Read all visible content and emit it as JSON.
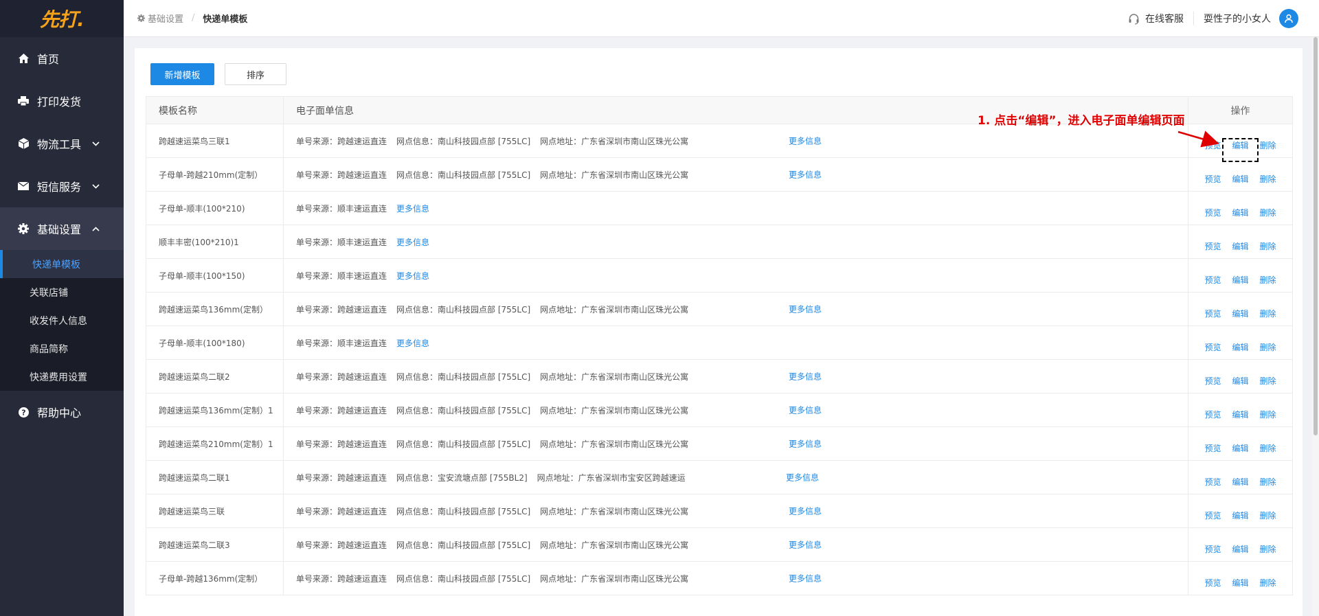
{
  "sidebar": {
    "logo": "先打.",
    "items": [
      {
        "label": "首页",
        "icon": "home-icon"
      },
      {
        "label": "打印发货",
        "icon": "printer-icon"
      },
      {
        "label": "物流工具",
        "icon": "package-icon"
      },
      {
        "label": "短信服务",
        "icon": "mail-icon"
      },
      {
        "label": "基础设置",
        "icon": "gear-icon"
      },
      {
        "label": "帮助中心",
        "icon": "help-icon"
      }
    ],
    "sub_items": [
      "快递单模板",
      "关联店铺",
      "收发件人信息",
      "商品简称",
      "快递费用设置"
    ]
  },
  "header": {
    "breadcrumb": [
      "基础设置",
      "快递单模板"
    ],
    "service": "在线客服",
    "user": "耍性子的小女人"
  },
  "toolbar": {
    "add_label": "新增模板",
    "sort_label": "排序"
  },
  "table": {
    "headers": [
      "模板名称",
      "电子面单信息",
      "操作"
    ],
    "actions": [
      "预览",
      "编辑",
      "删除"
    ],
    "more_label": "更多信息",
    "rows": [
      {
        "name": "跨越速运菜鸟三联1",
        "source": "单号来源：跨越速运直连",
        "point": "网点信息：南山科技园点部 [755LC]",
        "address": "网点地址：广东省深圳市南山区珠光公寓"
      },
      {
        "name": "子母单-跨越210mm(定制）",
        "source": "单号来源：跨越速运直连",
        "point": "网点信息：南山科技园点部 [755LC]",
        "address": "网点地址：广东省深圳市南山区珠光公寓"
      },
      {
        "name": "子母单-顺丰(100*210)",
        "source": "单号来源：顺丰速运直连",
        "point": "",
        "address": ""
      },
      {
        "name": "顺丰丰密(100*210)1",
        "source": "单号来源：顺丰速运直连",
        "point": "",
        "address": ""
      },
      {
        "name": "子母单-顺丰(100*150)",
        "source": "单号来源：顺丰速运直连",
        "point": "",
        "address": ""
      },
      {
        "name": "跨越速运菜鸟136mm(定制）",
        "source": "单号来源：跨越速运直连",
        "point": "网点信息：南山科技园点部 [755LC]",
        "address": "网点地址：广东省深圳市南山区珠光公寓"
      },
      {
        "name": "子母单-顺丰(100*180)",
        "source": "单号来源：顺丰速运直连",
        "point": "",
        "address": ""
      },
      {
        "name": "跨越速运菜鸟二联2",
        "source": "单号来源：跨越速运直连",
        "point": "网点信息：南山科技园点部 [755LC]",
        "address": "网点地址：广东省深圳市南山区珠光公寓"
      },
      {
        "name": "跨越速运菜鸟136mm(定制）1",
        "source": "单号来源：跨越速运直连",
        "point": "网点信息：南山科技园点部 [755LC]",
        "address": "网点地址：广东省深圳市南山区珠光公寓"
      },
      {
        "name": "跨越速运菜鸟210mm(定制）1",
        "source": "单号来源：跨越速运直连",
        "point": "网点信息：南山科技园点部 [755LC]",
        "address": "网点地址：广东省深圳市南山区珠光公寓"
      },
      {
        "name": "跨越速运菜鸟二联1",
        "source": "单号来源：跨越速运直连",
        "point": "网点信息：宝安流塘点部 [755BL2]",
        "address": "网点地址：广东省深圳市宝安区跨越速运"
      },
      {
        "name": "跨越速运菜鸟三联",
        "source": "单号来源：跨越速运直连",
        "point": "网点信息：南山科技园点部 [755LC]",
        "address": "网点地址：广东省深圳市南山区珠光公寓"
      },
      {
        "name": "跨越速运菜鸟二联3",
        "source": "单号来源：跨越速运直连",
        "point": "网点信息：南山科技园点部 [755LC]",
        "address": "网点地址：广东省深圳市南山区珠光公寓"
      },
      {
        "name": "子母单-跨越136mm(定制）",
        "source": "单号来源：跨越速运直连",
        "point": "网点信息：南山科技园点部 [755LC]",
        "address": "网点地址：广东省深圳市南山区珠光公寓"
      }
    ]
  },
  "annotation": {
    "text": "1. 点击“编辑”，进入电子面单编辑页面"
  },
  "colors": {
    "accent": "#1e88e5",
    "sidebar": "#272a39",
    "annotation": "#e00000"
  }
}
